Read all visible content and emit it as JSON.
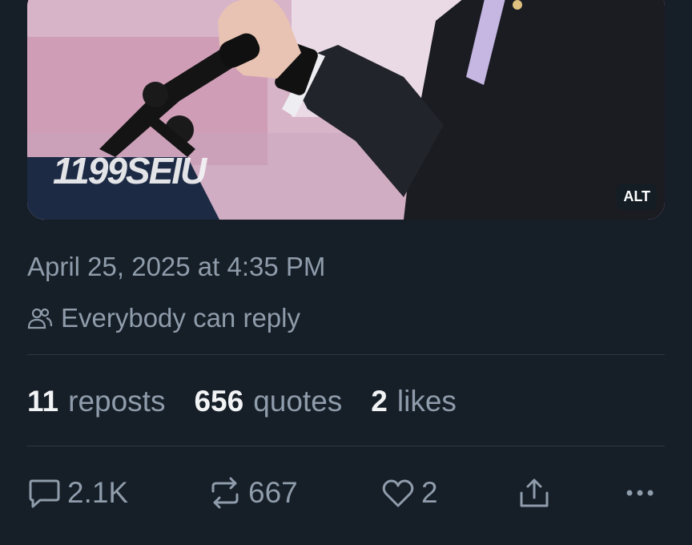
{
  "post": {
    "image_watermark": "1199SEIU",
    "alt_badge": "ALT",
    "timestamp": "April 25, 2025 at 4:35 PM",
    "reply_setting": "Everybody can reply"
  },
  "stats": [
    {
      "count": "11",
      "label": "reposts"
    },
    {
      "count": "656",
      "label": "quotes"
    },
    {
      "count": "2",
      "label": "likes"
    }
  ],
  "actions": {
    "reply_count": "2.1K",
    "repost_count": "667",
    "like_count": "2"
  },
  "icons": [
    "people-icon",
    "reply-icon",
    "repost-icon",
    "heart-icon",
    "share-icon",
    "more-icon"
  ]
}
